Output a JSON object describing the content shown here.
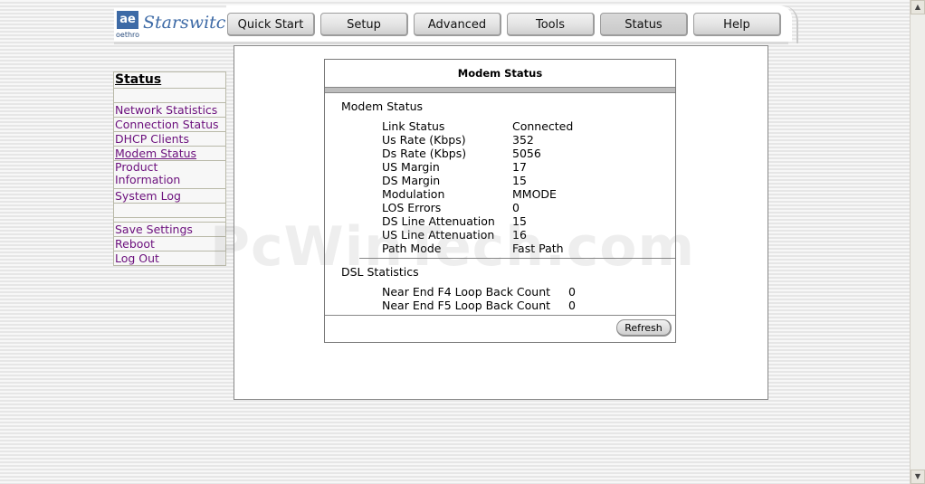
{
  "brand": {
    "mark": "ae",
    "company": "oethro",
    "product": "Starswitch"
  },
  "nav_tabs": [
    {
      "label": "Quick Start"
    },
    {
      "label": "Setup"
    },
    {
      "label": "Advanced"
    },
    {
      "label": "Tools"
    },
    {
      "label": "Status",
      "active": true
    },
    {
      "label": "Help"
    }
  ],
  "sidebar": {
    "title": "Status",
    "items": [
      {
        "label": "Network Statistics"
      },
      {
        "label": "Connection Status"
      },
      {
        "label": "DHCP Clients"
      },
      {
        "label": "Modem Status",
        "current": true
      },
      {
        "label": "Product Information"
      },
      {
        "label": "System Log"
      }
    ],
    "actions": [
      {
        "label": "Save Settings"
      },
      {
        "label": "Reboot"
      },
      {
        "label": "Log Out"
      }
    ]
  },
  "modem_status": {
    "title": "Modem Status",
    "section_title": "Modem Status",
    "rows": [
      {
        "key": "Link Status",
        "value": "Connected"
      },
      {
        "key": "Us Rate (Kbps)",
        "value": "352"
      },
      {
        "key": "Ds Rate (Kbps)",
        "value": "5056"
      },
      {
        "key": "US Margin",
        "value": "17"
      },
      {
        "key": "DS Margin",
        "value": "15"
      },
      {
        "key": "Modulation",
        "value": "MMODE"
      },
      {
        "key": "LOS Errors",
        "value": "0"
      },
      {
        "key": "DS Line Attenuation",
        "value": "15"
      },
      {
        "key": "US Line Attenuation",
        "value": "16"
      },
      {
        "key": "Path Mode",
        "value": "Fast Path"
      }
    ],
    "dsl_title": "DSL Statistics",
    "dsl_rows": [
      {
        "key": "Near End F4 Loop Back Count",
        "value": "0"
      },
      {
        "key": "Near End F5 Loop Back Count",
        "value": "0"
      }
    ],
    "refresh_label": "Refresh"
  },
  "watermark": "PcWinTech.com",
  "colors": {
    "link": "#6b0f7c",
    "accent": "#3d6aa6"
  }
}
